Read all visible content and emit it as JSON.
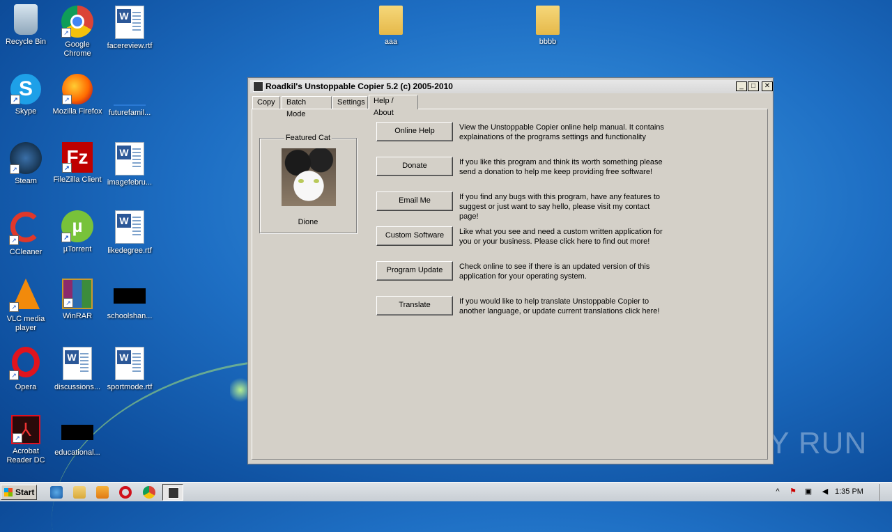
{
  "desktop": {
    "icons": [
      {
        "label": "Recycle Bin"
      },
      {
        "label": "Google Chrome"
      },
      {
        "label": "facereview.rtf"
      },
      {
        "label": "Skype"
      },
      {
        "label": "Mozilla Firefox"
      },
      {
        "label": "futurefamil..."
      },
      {
        "label": "Steam"
      },
      {
        "label": "FileZilla Client"
      },
      {
        "label": "imagefebru..."
      },
      {
        "label": "CCleaner"
      },
      {
        "label": "µTorrent"
      },
      {
        "label": "likedegree.rtf"
      },
      {
        "label": "VLC media player"
      },
      {
        "label": "WinRAR"
      },
      {
        "label": "schoolshan..."
      },
      {
        "label": "Opera"
      },
      {
        "label": "discussions..."
      },
      {
        "label": "sportmode.rtf"
      },
      {
        "label": "Acrobat Reader DC"
      },
      {
        "label": "educational..."
      },
      {
        "label": "aaa"
      },
      {
        "label": "bbbb"
      }
    ],
    "watermark": "ANY RUN"
  },
  "window": {
    "title": "Roadkil's Unstoppable Copier 5.2 (c) 2005-2010",
    "minimize": "_",
    "maximize": "□",
    "close": "✕",
    "tabs": [
      "Copy",
      "Batch Mode",
      "Settings",
      "Help / About"
    ],
    "active_tab": "Help / About",
    "featured": {
      "legend": "Featured Cat",
      "name": "Dione"
    },
    "actions": [
      {
        "button": "Online Help",
        "desc": "View the Unstoppable Copier online help manual.  It contains explainations of the programs settings and functionality"
      },
      {
        "button": "Donate",
        "desc": "If you like this program and think its worth something please send a donation to help me keep providing free software!"
      },
      {
        "button": "Email Me",
        "desc": "If you find any bugs with this program, have any features to suggest or just want to say hello, please visit my contact page!"
      },
      {
        "button": "Custom Software",
        "desc": "Like what you see and need a custom written application for you or your business.  Please click here to find out more!"
      },
      {
        "button": "Program Update",
        "desc": "Check online to see if there is an updated version of this application for your operating system."
      },
      {
        "button": "Translate",
        "desc": "If you would like to help translate Unstoppable Copier to another language, or update current translations click here!"
      }
    ]
  },
  "taskbar": {
    "start_label": "Start",
    "clock": "1:35 PM",
    "pinned": [
      "ie-icon",
      "explorer-icon",
      "media-player-icon",
      "opera-icon",
      "chrome-icon"
    ]
  }
}
